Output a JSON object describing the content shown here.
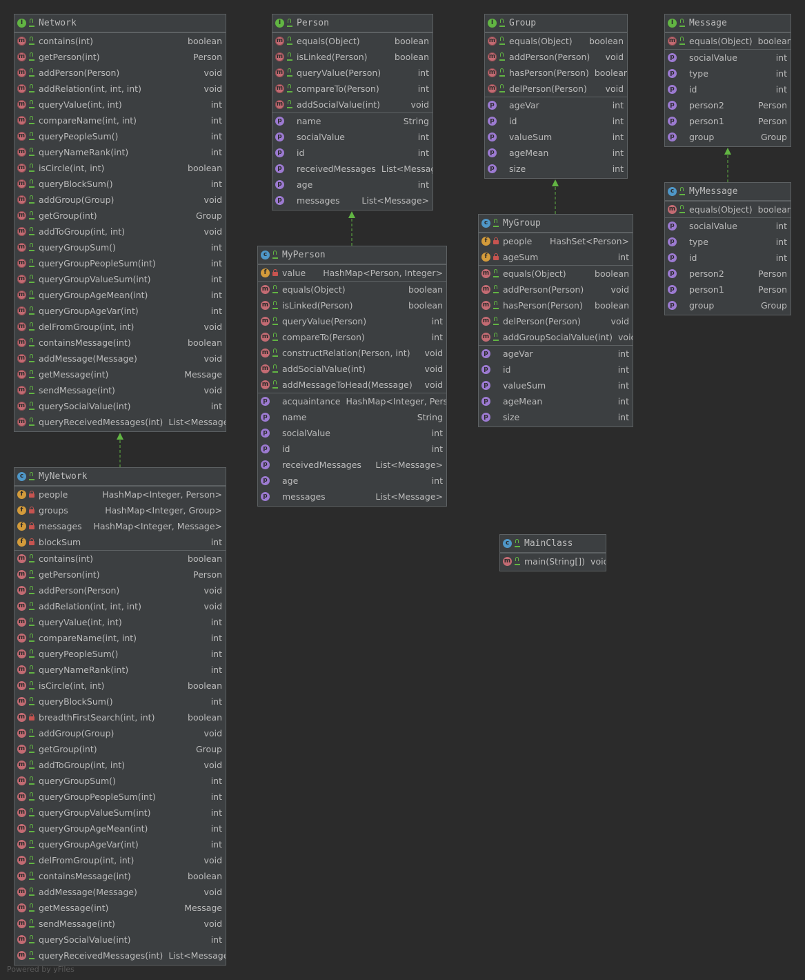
{
  "footer": "Powered by yFiles",
  "boxes": [
    {
      "id": "network",
      "title": "Network",
      "kind": "interface",
      "sections": [
        [
          {
            "k": "m",
            "name": "contains(int)",
            "type": "boolean"
          },
          {
            "k": "m",
            "name": "getPerson(int)",
            "type": "Person"
          },
          {
            "k": "m",
            "name": "addPerson(Person)",
            "type": "void"
          },
          {
            "k": "m",
            "name": "addRelation(int, int, int)",
            "type": "void"
          },
          {
            "k": "m",
            "name": "queryValue(int, int)",
            "type": "int"
          },
          {
            "k": "m",
            "name": "compareName(int, int)",
            "type": "int"
          },
          {
            "k": "m",
            "name": "queryPeopleSum()",
            "type": "int"
          },
          {
            "k": "m",
            "name": "queryNameRank(int)",
            "type": "int"
          },
          {
            "k": "m",
            "name": "isCircle(int, int)",
            "type": "boolean"
          },
          {
            "k": "m",
            "name": "queryBlockSum()",
            "type": "int"
          },
          {
            "k": "m",
            "name": "addGroup(Group)",
            "type": "void"
          },
          {
            "k": "m",
            "name": "getGroup(int)",
            "type": "Group"
          },
          {
            "k": "m",
            "name": "addToGroup(int, int)",
            "type": "void"
          },
          {
            "k": "m",
            "name": "queryGroupSum()",
            "type": "int"
          },
          {
            "k": "m",
            "name": "queryGroupPeopleSum(int)",
            "type": "int"
          },
          {
            "k": "m",
            "name": "queryGroupValueSum(int)",
            "type": "int"
          },
          {
            "k": "m",
            "name": "queryGroupAgeMean(int)",
            "type": "int"
          },
          {
            "k": "m",
            "name": "queryGroupAgeVar(int)",
            "type": "int"
          },
          {
            "k": "m",
            "name": "delFromGroup(int, int)",
            "type": "void"
          },
          {
            "k": "m",
            "name": "containsMessage(int)",
            "type": "boolean"
          },
          {
            "k": "m",
            "name": "addMessage(Message)",
            "type": "void"
          },
          {
            "k": "m",
            "name": "getMessage(int)",
            "type": "Message"
          },
          {
            "k": "m",
            "name": "sendMessage(int)",
            "type": "void"
          },
          {
            "k": "m",
            "name": "querySocialValue(int)",
            "type": "int"
          },
          {
            "k": "m",
            "name": "queryReceivedMessages(int)",
            "type": "List<Message>"
          }
        ]
      ]
    },
    {
      "id": "mynetwork",
      "title": "MyNetwork",
      "kind": "class",
      "sections": [
        [
          {
            "k": "f",
            "vis": "pri",
            "name": "people",
            "type": "HashMap<Integer, Person>"
          },
          {
            "k": "f",
            "vis": "pri",
            "name": "groups",
            "type": "HashMap<Integer, Group>"
          },
          {
            "k": "f",
            "vis": "pri",
            "name": "messages",
            "type": "HashMap<Integer, Message>"
          },
          {
            "k": "f",
            "vis": "pri",
            "name": "blockSum",
            "type": "int"
          }
        ],
        [
          {
            "k": "m",
            "name": "contains(int)",
            "type": "boolean"
          },
          {
            "k": "m",
            "name": "getPerson(int)",
            "type": "Person"
          },
          {
            "k": "m",
            "name": "addPerson(Person)",
            "type": "void"
          },
          {
            "k": "m",
            "name": "addRelation(int, int, int)",
            "type": "void"
          },
          {
            "k": "m",
            "name": "queryValue(int, int)",
            "type": "int"
          },
          {
            "k": "m",
            "name": "compareName(int, int)",
            "type": "int"
          },
          {
            "k": "m",
            "name": "queryPeopleSum()",
            "type": "int"
          },
          {
            "k": "m",
            "name": "queryNameRank(int)",
            "type": "int"
          },
          {
            "k": "m",
            "name": "isCircle(int, int)",
            "type": "boolean"
          },
          {
            "k": "m",
            "name": "queryBlockSum()",
            "type": "int"
          },
          {
            "k": "m",
            "vis": "pri",
            "name": "breadthFirstSearch(int, int)",
            "type": "boolean"
          },
          {
            "k": "m",
            "name": "addGroup(Group)",
            "type": "void"
          },
          {
            "k": "m",
            "name": "getGroup(int)",
            "type": "Group"
          },
          {
            "k": "m",
            "name": "addToGroup(int, int)",
            "type": "void"
          },
          {
            "k": "m",
            "name": "queryGroupSum()",
            "type": "int"
          },
          {
            "k": "m",
            "name": "queryGroupPeopleSum(int)",
            "type": "int"
          },
          {
            "k": "m",
            "name": "queryGroupValueSum(int)",
            "type": "int"
          },
          {
            "k": "m",
            "name": "queryGroupAgeMean(int)",
            "type": "int"
          },
          {
            "k": "m",
            "name": "queryGroupAgeVar(int)",
            "type": "int"
          },
          {
            "k": "m",
            "name": "delFromGroup(int, int)",
            "type": "void"
          },
          {
            "k": "m",
            "name": "containsMessage(int)",
            "type": "boolean"
          },
          {
            "k": "m",
            "name": "addMessage(Message)",
            "type": "void"
          },
          {
            "k": "m",
            "name": "getMessage(int)",
            "type": "Message"
          },
          {
            "k": "m",
            "name": "sendMessage(int)",
            "type": "void"
          },
          {
            "k": "m",
            "name": "querySocialValue(int)",
            "type": "int"
          },
          {
            "k": "m",
            "name": "queryReceivedMessages(int)",
            "type": "List<Message>"
          }
        ]
      ]
    },
    {
      "id": "person",
      "title": "Person",
      "kind": "interface",
      "sections": [
        [
          {
            "k": "m",
            "name": "equals(Object)",
            "type": "boolean"
          },
          {
            "k": "m",
            "name": "isLinked(Person)",
            "type": "boolean"
          },
          {
            "k": "m",
            "name": "queryValue(Person)",
            "type": "int"
          },
          {
            "k": "m",
            "name": "compareTo(Person)",
            "type": "int"
          },
          {
            "k": "m",
            "name": "addSocialValue(int)",
            "type": "void"
          }
        ],
        [
          {
            "k": "p",
            "name": "name",
            "type": "String"
          },
          {
            "k": "p",
            "name": "socialValue",
            "type": "int"
          },
          {
            "k": "p",
            "name": "id",
            "type": "int"
          },
          {
            "k": "p",
            "name": "receivedMessages",
            "type": "List<Message>"
          },
          {
            "k": "p",
            "name": "age",
            "type": "int"
          },
          {
            "k": "p",
            "name": "messages",
            "type": "List<Message>"
          }
        ]
      ]
    },
    {
      "id": "myperson",
      "title": "MyPerson",
      "kind": "class",
      "sections": [
        [
          {
            "k": "f",
            "vis": "pri",
            "name": "value",
            "type": "HashMap<Person, Integer>"
          }
        ],
        [
          {
            "k": "m",
            "name": "equals(Object)",
            "type": "boolean"
          },
          {
            "k": "m",
            "name": "isLinked(Person)",
            "type": "boolean"
          },
          {
            "k": "m",
            "name": "queryValue(Person)",
            "type": "int"
          },
          {
            "k": "m",
            "name": "compareTo(Person)",
            "type": "int"
          },
          {
            "k": "m",
            "name": "constructRelation(Person, int)",
            "type": "void"
          },
          {
            "k": "m",
            "name": "addSocialValue(int)",
            "type": "void"
          },
          {
            "k": "m",
            "name": "addMessageToHead(Message)",
            "type": "void"
          }
        ],
        [
          {
            "k": "p",
            "name": "acquaintance",
            "type": "HashMap<Integer, Person>"
          },
          {
            "k": "p",
            "name": "name",
            "type": "String"
          },
          {
            "k": "p",
            "name": "socialValue",
            "type": "int"
          },
          {
            "k": "p",
            "name": "id",
            "type": "int"
          },
          {
            "k": "p",
            "name": "receivedMessages",
            "type": "List<Message>"
          },
          {
            "k": "p",
            "name": "age",
            "type": "int"
          },
          {
            "k": "p",
            "name": "messages",
            "type": "List<Message>"
          }
        ]
      ]
    },
    {
      "id": "group",
      "title": "Group",
      "kind": "interface",
      "sections": [
        [
          {
            "k": "m",
            "name": "equals(Object)",
            "type": "boolean"
          },
          {
            "k": "m",
            "name": "addPerson(Person)",
            "type": "void"
          },
          {
            "k": "m",
            "name": "hasPerson(Person)",
            "type": "boolean"
          },
          {
            "k": "m",
            "name": "delPerson(Person)",
            "type": "void"
          }
        ],
        [
          {
            "k": "p",
            "name": "ageVar",
            "type": "int"
          },
          {
            "k": "p",
            "name": "id",
            "type": "int"
          },
          {
            "k": "p",
            "name": "valueSum",
            "type": "int"
          },
          {
            "k": "p",
            "name": "ageMean",
            "type": "int"
          },
          {
            "k": "p",
            "name": "size",
            "type": "int"
          }
        ]
      ]
    },
    {
      "id": "mygroup",
      "title": "MyGroup",
      "kind": "class",
      "sections": [
        [
          {
            "k": "f",
            "vis": "pri",
            "name": "people",
            "type": "HashSet<Person>"
          },
          {
            "k": "f",
            "vis": "pri",
            "name": "ageSum",
            "type": "int"
          }
        ],
        [
          {
            "k": "m",
            "name": "equals(Object)",
            "type": "boolean"
          },
          {
            "k": "m",
            "name": "addPerson(Person)",
            "type": "void"
          },
          {
            "k": "m",
            "name": "hasPerson(Person)",
            "type": "boolean"
          },
          {
            "k": "m",
            "name": "delPerson(Person)",
            "type": "void"
          },
          {
            "k": "m",
            "name": "addGroupSocialValue(int)",
            "type": "void"
          }
        ],
        [
          {
            "k": "p",
            "name": "ageVar",
            "type": "int"
          },
          {
            "k": "p",
            "name": "id",
            "type": "int"
          },
          {
            "k": "p",
            "name": "valueSum",
            "type": "int"
          },
          {
            "k": "p",
            "name": "ageMean",
            "type": "int"
          },
          {
            "k": "p",
            "name": "size",
            "type": "int"
          }
        ]
      ]
    },
    {
      "id": "message",
      "title": "Message",
      "kind": "interface",
      "sections": [
        [
          {
            "k": "m",
            "name": "equals(Object)",
            "type": "boolean"
          }
        ],
        [
          {
            "k": "p",
            "name": "socialValue",
            "type": "int"
          },
          {
            "k": "p",
            "name": "type",
            "type": "int"
          },
          {
            "k": "p",
            "name": "id",
            "type": "int"
          },
          {
            "k": "p",
            "name": "person2",
            "type": "Person"
          },
          {
            "k": "p",
            "name": "person1",
            "type": "Person"
          },
          {
            "k": "p",
            "name": "group",
            "type": "Group"
          }
        ]
      ]
    },
    {
      "id": "mymessage",
      "title": "MyMessage",
      "kind": "class",
      "sections": [
        [
          {
            "k": "m",
            "name": "equals(Object)",
            "type": "boolean"
          }
        ],
        [
          {
            "k": "p",
            "name": "socialValue",
            "type": "int"
          },
          {
            "k": "p",
            "name": "type",
            "type": "int"
          },
          {
            "k": "p",
            "name": "id",
            "type": "int"
          },
          {
            "k": "p",
            "name": "person2",
            "type": "Person"
          },
          {
            "k": "p",
            "name": "person1",
            "type": "Person"
          },
          {
            "k": "p",
            "name": "group",
            "type": "Group"
          }
        ]
      ]
    },
    {
      "id": "mainclass",
      "title": "MainClass",
      "kind": "class",
      "sections": [
        [
          {
            "k": "m",
            "name": "main(String[])",
            "type": "void"
          }
        ]
      ]
    }
  ],
  "relations": [
    {
      "from": "mynetwork",
      "to": "network",
      "type": "implements"
    },
    {
      "from": "myperson",
      "to": "person",
      "type": "implements"
    },
    {
      "from": "mygroup",
      "to": "group",
      "type": "implements"
    },
    {
      "from": "mymessage",
      "to": "message",
      "type": "implements"
    }
  ],
  "colors": {
    "background": "#2b2b2b",
    "box": "#3c3f41",
    "border": "#5d6163",
    "arrow": "#62b543",
    "text": "#bbbbbb"
  }
}
